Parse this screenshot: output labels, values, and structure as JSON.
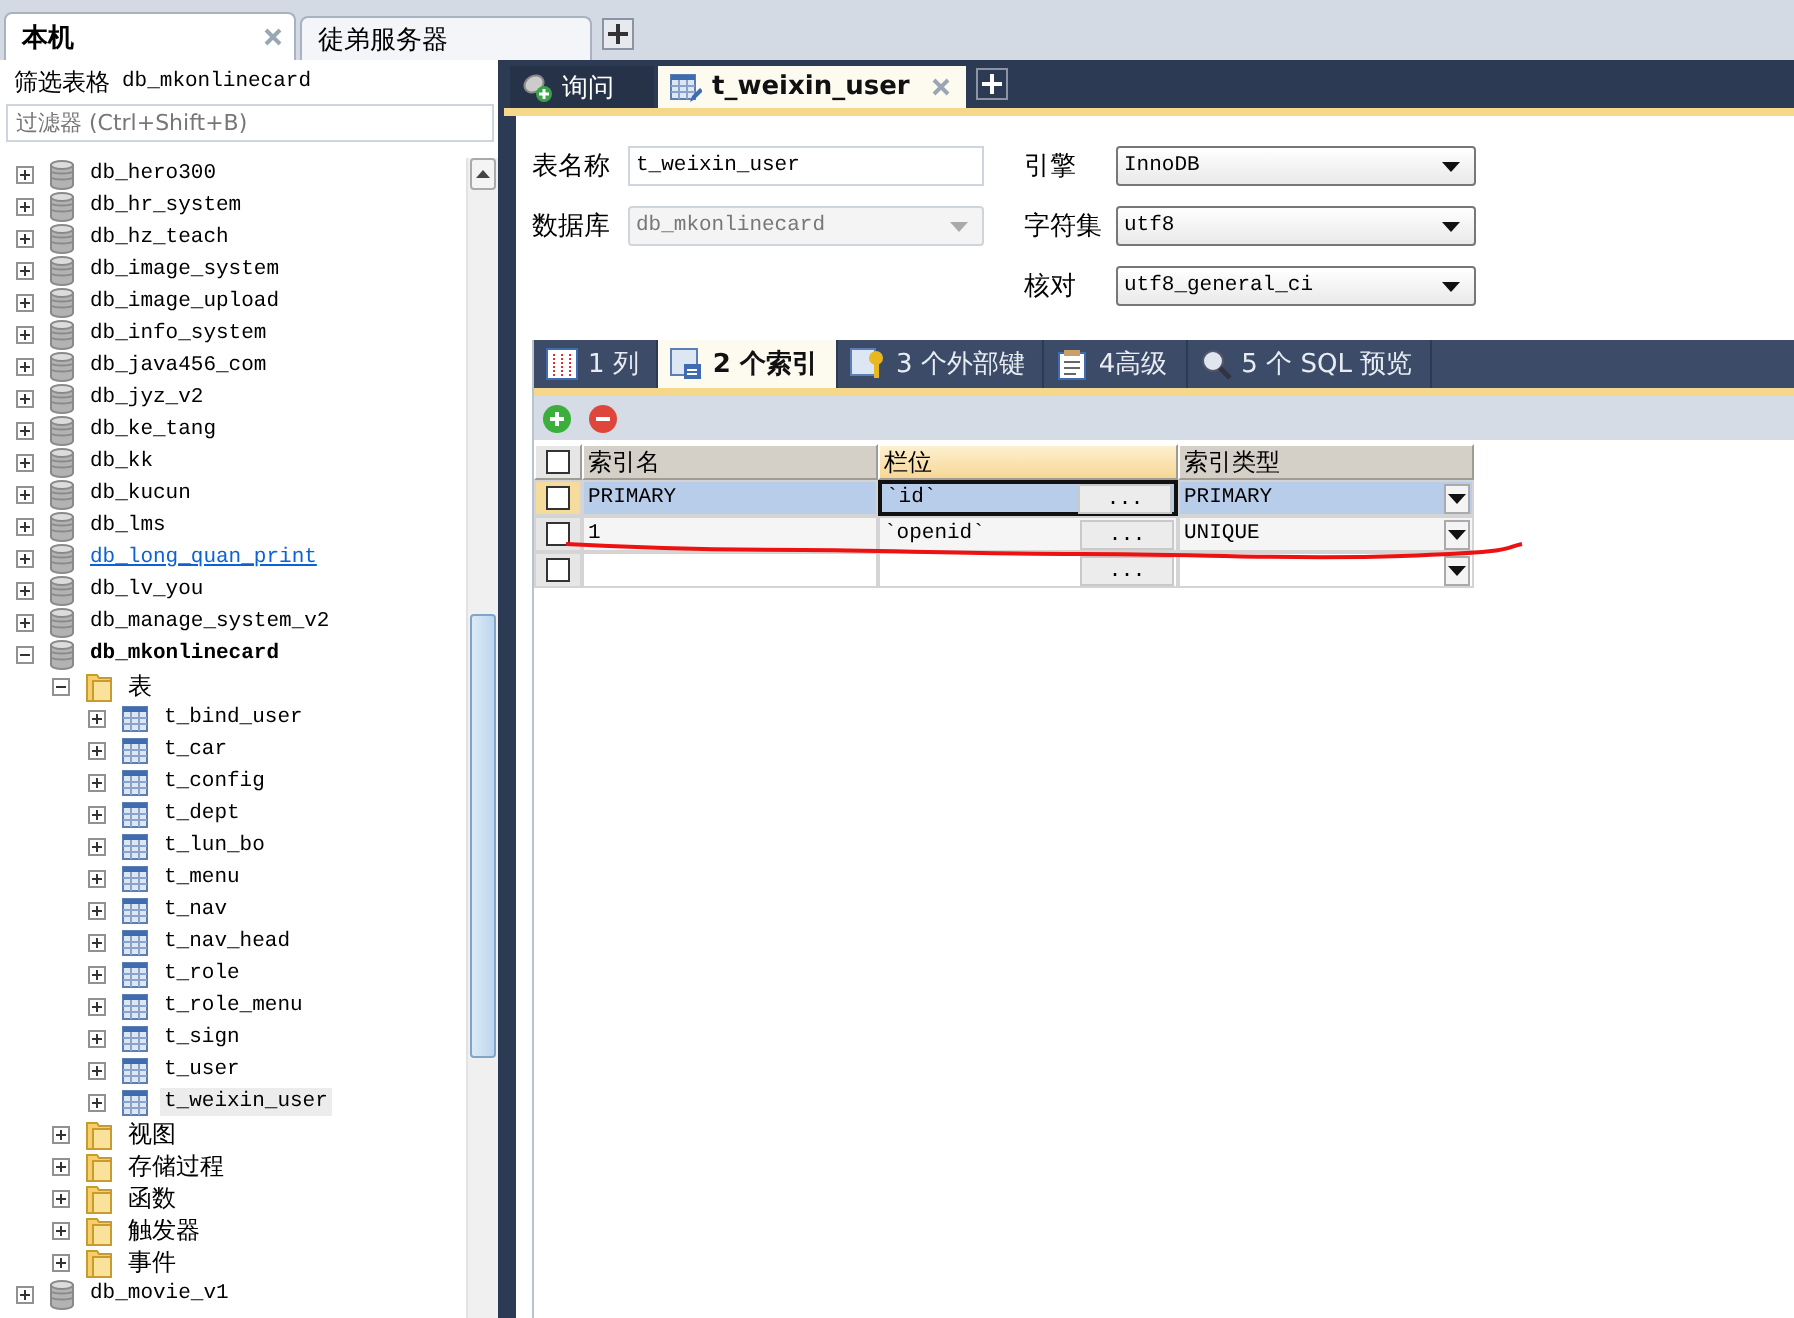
{
  "connection_tabs": [
    {
      "label": "本机",
      "selected": true
    },
    {
      "label": "徒弟服务器",
      "selected": false
    }
  ],
  "filter": {
    "label": "筛选表格",
    "database": "db_mkonlinecard",
    "placeholder": "过滤器 (Ctrl+Shift+B)"
  },
  "tree": [
    {
      "label": "db_hero300",
      "kind": "database",
      "expanded": false,
      "selected": false,
      "hovered": false
    },
    {
      "label": "db_hr_system",
      "kind": "database",
      "expanded": false,
      "selected": false,
      "hovered": false
    },
    {
      "label": "db_hz_teach",
      "kind": "database",
      "expanded": false,
      "selected": false,
      "hovered": false
    },
    {
      "label": "db_image_system",
      "kind": "database",
      "expanded": false,
      "selected": false,
      "hovered": false
    },
    {
      "label": "db_image_upload",
      "kind": "database",
      "expanded": false,
      "selected": false,
      "hovered": false
    },
    {
      "label": "db_info_system",
      "kind": "database",
      "expanded": false,
      "selected": false,
      "hovered": false
    },
    {
      "label": "db_java456_com",
      "kind": "database",
      "expanded": false,
      "selected": false,
      "hovered": false
    },
    {
      "label": "db_jyz_v2",
      "kind": "database",
      "expanded": false,
      "selected": false,
      "hovered": false
    },
    {
      "label": "db_ke_tang",
      "kind": "database",
      "expanded": false,
      "selected": false,
      "hovered": false
    },
    {
      "label": "db_kk",
      "kind": "database",
      "expanded": false,
      "selected": false,
      "hovered": false
    },
    {
      "label": "db_kucun",
      "kind": "database",
      "expanded": false,
      "selected": false,
      "hovered": false
    },
    {
      "label": "db_lms",
      "kind": "database",
      "expanded": false,
      "selected": false,
      "hovered": false
    },
    {
      "label": "db_long_quan_print",
      "kind": "database",
      "expanded": false,
      "selected": false,
      "hovered": true
    },
    {
      "label": "db_lv_you",
      "kind": "database",
      "expanded": false,
      "selected": false,
      "hovered": false
    },
    {
      "label": "db_manage_system_v2",
      "kind": "database",
      "expanded": false,
      "selected": false,
      "hovered": false
    },
    {
      "label": "db_mkonlinecard",
      "kind": "database",
      "expanded": true,
      "selected": false,
      "hovered": false,
      "children": [
        {
          "label": "表",
          "kind": "folder",
          "expanded": true,
          "selected": false,
          "hovered": false,
          "children": [
            {
              "label": "t_bind_user",
              "kind": "table",
              "expanded": false,
              "selected": false,
              "hovered": false
            },
            {
              "label": "t_car",
              "kind": "table",
              "expanded": false,
              "selected": false,
              "hovered": false
            },
            {
              "label": "t_config",
              "kind": "table",
              "expanded": false,
              "selected": false,
              "hovered": false
            },
            {
              "label": "t_dept",
              "kind": "table",
              "expanded": false,
              "selected": false,
              "hovered": false
            },
            {
              "label": "t_lun_bo",
              "kind": "table",
              "expanded": false,
              "selected": false,
              "hovered": false
            },
            {
              "label": "t_menu",
              "kind": "table",
              "expanded": false,
              "selected": false,
              "hovered": false
            },
            {
              "label": "t_nav",
              "kind": "table",
              "expanded": false,
              "selected": false,
              "hovered": false
            },
            {
              "label": "t_nav_head",
              "kind": "table",
              "expanded": false,
              "selected": false,
              "hovered": false
            },
            {
              "label": "t_role",
              "kind": "table",
              "expanded": false,
              "selected": false,
              "hovered": false
            },
            {
              "label": "t_role_menu",
              "kind": "table",
              "expanded": false,
              "selected": false,
              "hovered": false
            },
            {
              "label": "t_sign",
              "kind": "table",
              "expanded": false,
              "selected": false,
              "hovered": false
            },
            {
              "label": "t_user",
              "kind": "table",
              "expanded": false,
              "selected": false,
              "hovered": false
            },
            {
              "label": "t_weixin_user",
              "kind": "table",
              "expanded": false,
              "selected": true,
              "hovered": false
            }
          ]
        },
        {
          "label": "视图",
          "kind": "folder",
          "expanded": false,
          "selected": false,
          "hovered": false
        },
        {
          "label": "存储过程",
          "kind": "folder",
          "expanded": false,
          "selected": false,
          "hovered": false
        },
        {
          "label": "函数",
          "kind": "folder",
          "expanded": false,
          "selected": false,
          "hovered": false
        },
        {
          "label": "触发器",
          "kind": "folder",
          "expanded": false,
          "selected": false,
          "hovered": false
        },
        {
          "label": "事件",
          "kind": "folder",
          "expanded": false,
          "selected": false,
          "hovered": false
        }
      ]
    },
    {
      "label": "db_movie_v1",
      "kind": "database",
      "expanded": false,
      "selected": false,
      "hovered": false
    }
  ],
  "editor_tabs": [
    {
      "label": "询问",
      "kind": "query",
      "selected": false
    },
    {
      "label": "t_weixin_user",
      "kind": "table",
      "selected": true
    }
  ],
  "form_left": [
    {
      "label": "表名称",
      "value": "t_weixin_user",
      "kind": "text",
      "disabled": false
    },
    {
      "label": "数据库",
      "value": "db_mkonlinecard",
      "kind": "select",
      "disabled": true
    }
  ],
  "form_right": [
    {
      "label": "引擎",
      "value": "InnoDB",
      "kind": "select",
      "disabled": false
    },
    {
      "label": "字符集",
      "value": "utf8",
      "kind": "select",
      "disabled": false
    },
    {
      "label": "核对",
      "value": "utf8_general_ci",
      "kind": "select",
      "disabled": false
    }
  ],
  "subtabs": [
    {
      "label": "1 列",
      "kind": "columns",
      "selected": false
    },
    {
      "label": "2 个索引",
      "kind": "indexes",
      "selected": true
    },
    {
      "label": "3 个外部键",
      "kind": "foreign",
      "selected": false
    },
    {
      "label": "4高级",
      "kind": "advanced",
      "selected": false
    },
    {
      "label": "5 个 SQL 预览",
      "kind": "sql",
      "selected": false
    }
  ],
  "index_table": {
    "all_checked": false,
    "columns": [
      {
        "label": "索引名",
        "selected": false
      },
      {
        "label": "栏位",
        "selected": true
      },
      {
        "label": "索引类型",
        "selected": false
      }
    ],
    "rows": [
      {
        "name": "PRIMARY",
        "fields": "`id`",
        "fields_button": "...",
        "type": "PRIMARY",
        "selected": true,
        "checked": false
      },
      {
        "name": "1",
        "fields": "`openid`",
        "fields_button": "...",
        "type": "UNIQUE",
        "selected": false,
        "checked": false
      },
      {
        "fields_button": "...",
        "selected": false,
        "checked": false
      }
    ]
  }
}
